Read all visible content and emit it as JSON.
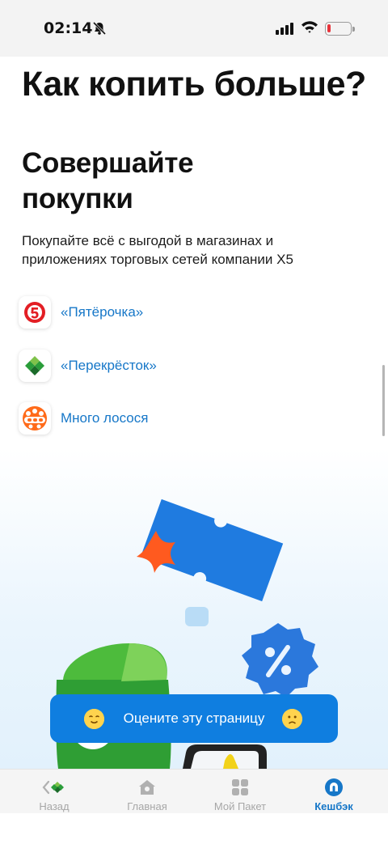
{
  "status_bar": {
    "time": "02:14"
  },
  "page": {
    "title": "Как копить больше?",
    "section_title": "Совершайте покупки",
    "section_description": "Покупайте всё с выгодой в магазинах и приложениях торговых сетей компании X5"
  },
  "stores": [
    {
      "label": "«Пятёрочка»",
      "icon": "pyaterochka-logo"
    },
    {
      "label": "«Перекрёсток»",
      "icon": "perekrestok-logo"
    },
    {
      "label": "Много лосося",
      "icon": "mnogo-lososya-logo"
    }
  ],
  "rate_button": {
    "label": "Оцените эту страницу"
  },
  "tabbar": {
    "tabs": [
      {
        "label": "Назад",
        "icon": "back-icon"
      },
      {
        "label": "Главная",
        "icon": "home-icon"
      },
      {
        "label": "Мой Пакет",
        "icon": "grid-icon"
      },
      {
        "label": "Кешбэк",
        "icon": "cashback-icon"
      }
    ],
    "active_tab": "Кешбэк"
  },
  "colors": {
    "accent": "#0f7ee0",
    "link": "#1677c8",
    "pyaterochka_red": "#e31e24",
    "perekrestok_green": "#2a9d3a",
    "orange": "#ff6b1a"
  }
}
